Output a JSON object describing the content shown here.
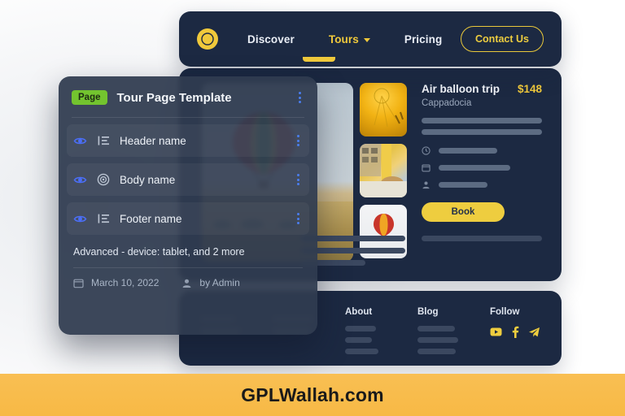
{
  "navbar": {
    "logo_icon": "compass-icon",
    "links": [
      {
        "label": "Discover",
        "active": false,
        "has_caret": false
      },
      {
        "label": "Tours",
        "active": true,
        "has_caret": true
      },
      {
        "label": "Pricing",
        "active": false,
        "has_caret": false
      }
    ],
    "cta_label": "Contact Us"
  },
  "product": {
    "title": "Air balloon trip",
    "price": "$148",
    "location": "Cappadocia",
    "book_label": "Book",
    "meta_icons": [
      "clock-icon",
      "calendar-icon",
      "person-icon"
    ],
    "thumbnails": [
      "balloon-closeup-thumb",
      "balloon-basket-thumb",
      "balloon-sky-thumb"
    ],
    "hero_image": "hot-air-balloon-hero"
  },
  "site_footer": {
    "columns": [
      {
        "title": "",
        "lines": 3
      },
      {
        "title": "",
        "lines": 3
      },
      {
        "title": "About",
        "lines": 3
      },
      {
        "title": "Blog",
        "lines": 3
      },
      {
        "title": "Follow",
        "lines": 0
      }
    ],
    "socials": [
      "youtube-icon",
      "facebook-icon",
      "telegram-icon"
    ]
  },
  "panel": {
    "badge": "Page",
    "title": "Tour Page Template",
    "menu_icon": "kebab-menu-icon",
    "rows": [
      {
        "label": "Header name",
        "visibility_icon": "eye-icon",
        "type_icon": "list-icon",
        "menu_icon": "kebab-menu-icon",
        "highlighted": true
      },
      {
        "label": "Body name",
        "visibility_icon": "eye-icon",
        "type_icon": "target-icon",
        "menu_icon": "kebab-menu-icon",
        "highlighted": true
      },
      {
        "label": "Footer name",
        "visibility_icon": "eye-icon",
        "type_icon": "list-icon",
        "menu_icon": "kebab-menu-icon",
        "highlighted": true
      }
    ],
    "conditions": "Advanced - device: tablet, and 2 more",
    "date": "March 10, 2022",
    "author": "by Admin",
    "date_icon": "calendar-icon",
    "author_icon": "person-icon"
  },
  "banner": {
    "text": "GPLWallah.com"
  },
  "colors": {
    "accent_yellow": "#eecd3f",
    "panel_navy": "#1c2942",
    "floating_panel": "#303c50",
    "badge_green": "#73c42f",
    "dots_blue": "#4a7ef0",
    "banner_orange": "#f8bc4c"
  }
}
